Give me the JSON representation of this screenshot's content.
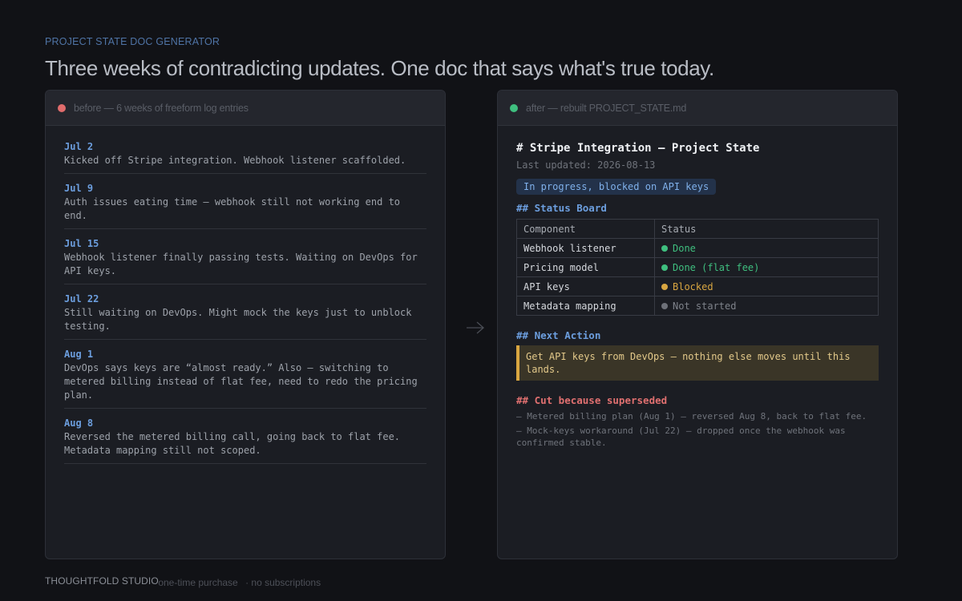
{
  "eyebrow": "PROJECT STATE DOC GENERATOR",
  "headline": "Three weeks of contradicting updates. One doc that says what's true today.",
  "before": {
    "title": "before — 6 weeks of freeform log entries",
    "entries": [
      {
        "date": "Jul 2",
        "text": "Kicked off Stripe integration. Webhook listener scaffolded."
      },
      {
        "date": "Jul 9",
        "text": "Auth issues eating time — webhook still not working end to end."
      },
      {
        "date": "Jul 15",
        "text": "Webhook listener finally passing tests. Waiting on DevOps for API keys."
      },
      {
        "date": "Jul 22",
        "text": "Still waiting on DevOps. Might mock the keys just to unblock testing."
      },
      {
        "date": "Aug 1",
        "text": "DevOps says keys are “almost ready.” Also — switching to metered billing instead of flat fee, need to redo the pricing plan."
      },
      {
        "date": "Aug 8",
        "text": "Reversed the metered billing call, going back to flat fee. Metadata mapping still not scoped."
      }
    ]
  },
  "after": {
    "title": "after — rebuilt PROJECT_STATE.md",
    "doc_title": "# Stripe Integration — Project State",
    "updated": "Last updated: 2026-08-13",
    "badge": "In progress, blocked on API keys",
    "status_heading": "## Status Board",
    "table_headers": [
      "Component",
      "Status"
    ],
    "rows": [
      {
        "component": "Webhook listener",
        "status": "Done",
        "state": "done"
      },
      {
        "component": "Pricing model",
        "status": "Done (flat fee)",
        "state": "done"
      },
      {
        "component": "API keys",
        "status": "Blocked",
        "state": "blocked"
      },
      {
        "component": "Metadata mapping",
        "status": "Not started",
        "state": "not"
      }
    ],
    "next_heading": "## Next Action",
    "next_action": "Get API keys from DevOps — nothing else moves until this lands.",
    "cut_heading": "## Cut because superseded",
    "cut_items": [
      "— Metered billing plan (Aug 1) — reversed Aug 8, back to flat fee.",
      "— Mock-keys workaround (Jul 22) — dropped once the webhook was confirmed stable."
    ]
  },
  "footer": {
    "brand": "THOUGHTFOLD STUDIO",
    "tags": [
      "· one-time purchase",
      "· no subscriptions"
    ]
  },
  "colors": {
    "background": "#111216",
    "accent_blue": "#6c9ede",
    "done_green": "#3fbf7f",
    "blocked_amber": "#d9a641",
    "cut_red": "#e07070"
  }
}
